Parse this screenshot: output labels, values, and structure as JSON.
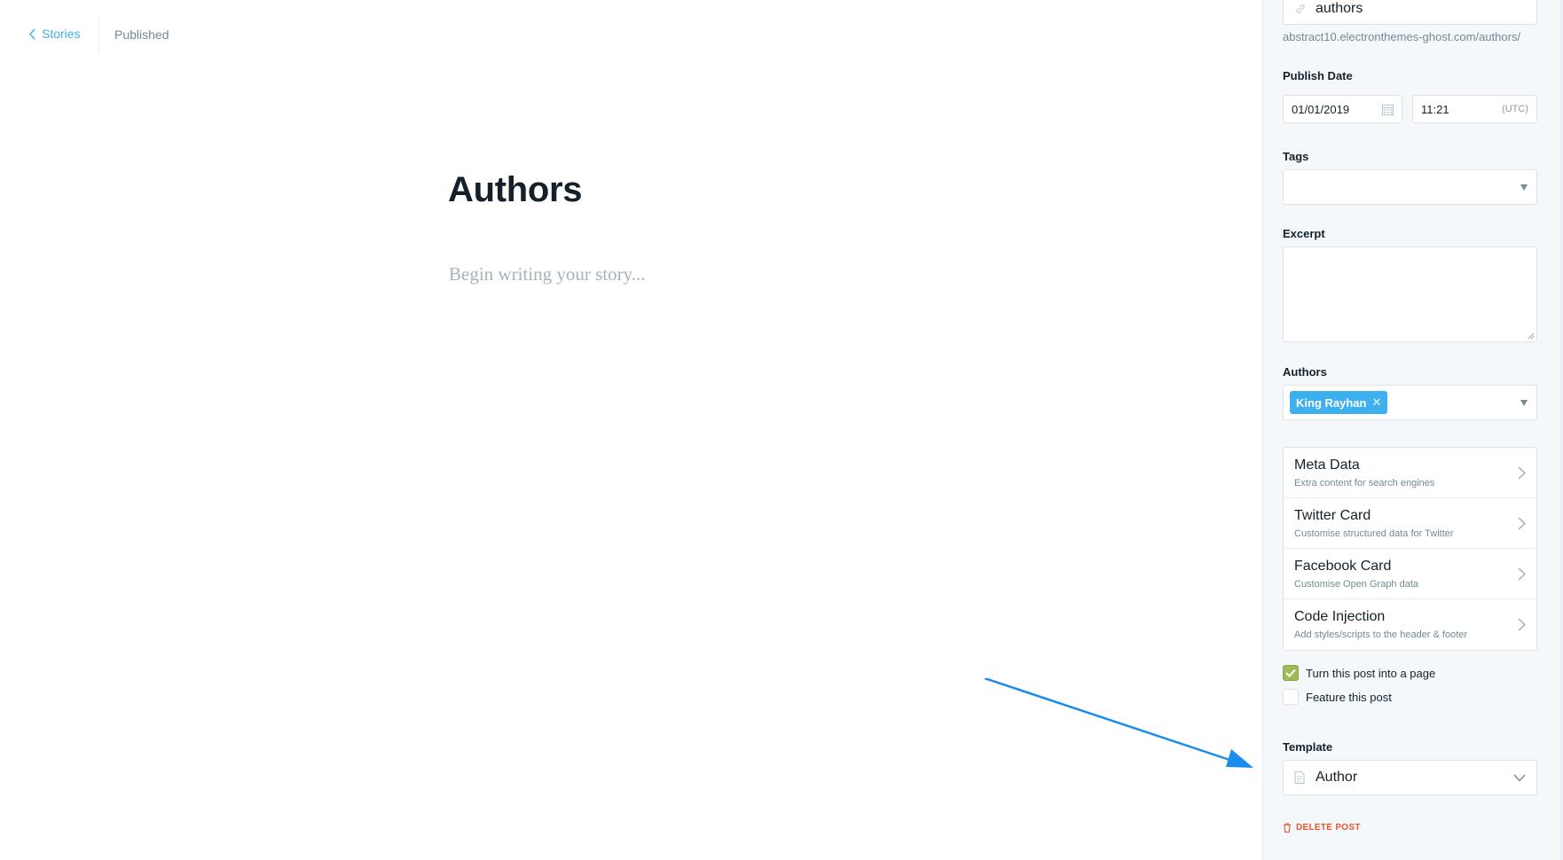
{
  "header": {
    "back_label": "Stories",
    "status": "Published"
  },
  "editor": {
    "title": "Authors",
    "placeholder": "Begin writing your story..."
  },
  "settings": {
    "url": {
      "value": "authors",
      "preview": "abstract10.electronthemes-ghost.com/authors/"
    },
    "publish_date": {
      "label": "Publish Date",
      "date": "01/01/2019",
      "time": "11:21",
      "timezone": "(UTC)"
    },
    "tags": {
      "label": "Tags"
    },
    "excerpt": {
      "label": "Excerpt"
    },
    "authors": {
      "label": "Authors",
      "selected": [
        "King Rayhan"
      ]
    },
    "menu": [
      {
        "title": "Meta Data",
        "subtitle": "Extra content for search engines"
      },
      {
        "title": "Twitter Card",
        "subtitle": "Customise structured data for Twitter"
      },
      {
        "title": "Facebook Card",
        "subtitle": "Customise Open Graph data"
      },
      {
        "title": "Code Injection",
        "subtitle": "Add styles/scripts to the header & footer"
      }
    ],
    "checks": {
      "page": {
        "label": "Turn this post into a page",
        "checked": true
      },
      "featured": {
        "label": "Feature this post",
        "checked": false
      }
    },
    "template": {
      "label": "Template",
      "value": "Author"
    },
    "delete_label": "DELETE POST"
  },
  "colors": {
    "accent": "#3eb0ef",
    "checkbox_on": "#9fbb58",
    "danger": "#f05230",
    "annotation_arrow": "#1a8cf0"
  },
  "icons": {
    "back": "chevron-left-icon",
    "url": "link-icon",
    "date": "calendar-icon",
    "menu": "chevron-right-icon",
    "template": "document-icon",
    "template_toggle": "chevron-down-icon",
    "delete": "trash-icon"
  }
}
